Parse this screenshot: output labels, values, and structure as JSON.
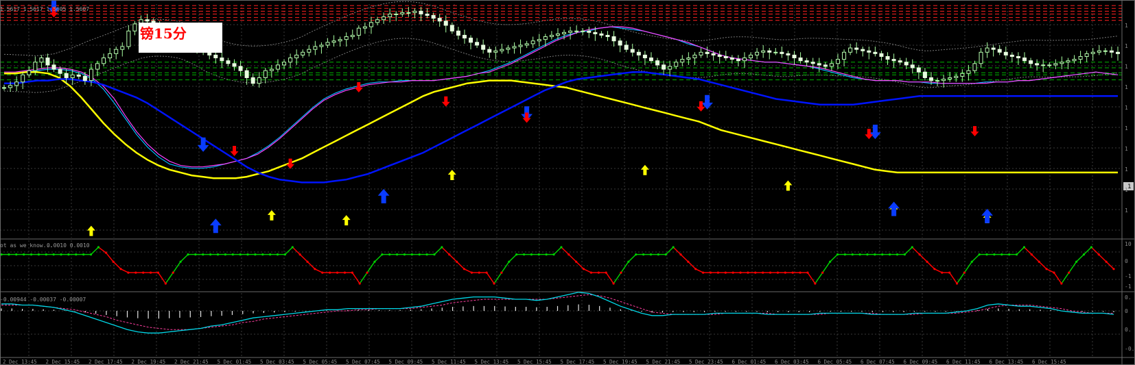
{
  "label": "镑15分",
  "main_panel": {
    "ohlc_readout": "1.5617 1.5617 1.5605 1.5607",
    "price_label": "1"
  },
  "osc_panel": {
    "name": "ot as we know...",
    "values_readout": "0.0010 0.0010",
    "scale": [
      "10",
      "0",
      "-1",
      "-1"
    ]
  },
  "macd_panel": {
    "values_readout": "-0.00944 -0.00037 -0.00007",
    "scale": [
      "0.",
      "0",
      "0.",
      "-0."
    ]
  },
  "colors": {
    "bull": "#b8ffb0",
    "bear": "#e8ffe0",
    "ma_fast": "#00b4ff",
    "ma_slow": "#ff40ff",
    "ma_yellow": "#ffff00",
    "ma_blue": "#0014ff",
    "arrow_down": "#ff0000",
    "arrow_up_yellow": "#ffff00",
    "arrow_up_blue": "#0a3cff",
    "osc_green": "#00d000",
    "osc_red": "#ff0000",
    "level_green": "#00b800",
    "level_red": "#ff2020",
    "macd_signal": "#ff3fa0",
    "macd_main": "#00d8e8"
  },
  "chart_data": {
    "type": "candlestick",
    "x_tick_labels": [
      "2 Dec 13:45",
      "2 Dec 15:45",
      "2 Dec 17:45",
      "2 Dec 19:45",
      "2 Dec 21:45",
      "5 Dec 01:45",
      "5 Dec 03:45",
      "5 Dec 05:45",
      "5 Dec 07:45",
      "5 Dec 09:45",
      "5 Dec 11:45",
      "5 Dec 13:45",
      "5 Dec 15:45",
      "5 Dec 17:45",
      "5 Dec 19:45",
      "5 Dec 21:45",
      "5 Dec 23:45",
      "6 Dec 01:45",
      "6 Dec 03:45",
      "6 Dec 05:45",
      "6 Dec 07:45",
      "6 Dec 09:45",
      "6 Dec 11:45",
      "6 Dec 13:45",
      "6 Dec 15:45"
    ],
    "y_range": [
      0,
      330
    ],
    "closes": [
      212,
      215,
      220,
      230,
      236,
      248,
      254,
      244,
      238,
      232,
      226,
      230,
      228,
      222,
      238,
      246,
      254,
      260,
      266,
      270,
      292,
      302,
      308,
      306,
      300,
      296,
      290,
      288,
      282,
      278,
      274,
      270,
      262,
      258,
      254,
      250,
      246,
      242,
      236,
      226,
      218,
      226,
      236,
      238,
      244,
      248,
      254,
      258,
      262,
      266,
      270,
      272,
      276,
      278,
      280,
      284,
      286,
      296,
      298,
      304,
      308,
      312,
      316,
      316,
      318,
      318,
      320,
      316,
      314,
      310,
      306,
      300,
      292,
      286,
      282,
      276,
      272,
      266,
      262,
      264,
      266,
      268,
      270,
      272,
      274,
      278,
      280,
      284,
      286,
      288,
      290,
      292,
      292,
      292,
      290,
      288,
      286,
      284,
      278,
      272,
      266,
      262,
      258,
      254,
      250,
      244,
      238,
      242,
      248,
      252,
      254,
      258,
      262,
      260,
      258,
      256,
      254,
      252,
      250,
      254,
      258,
      262,
      264,
      262,
      262,
      260,
      258,
      254,
      250,
      248,
      246,
      244,
      242,
      246,
      252,
      262,
      268,
      266,
      264,
      262,
      260,
      256,
      252,
      250,
      248,
      244,
      240,
      234,
      226,
      222,
      222,
      224,
      226,
      228,
      232,
      236,
      246,
      262,
      268,
      266,
      262,
      258,
      256,
      254,
      250,
      246,
      244,
      244,
      244,
      246,
      248,
      250,
      252,
      256,
      260,
      262,
      264,
      264,
      262,
      260
    ],
    "series": [
      {
        "name": "",
        "kind": "ma_fast",
        "values": [
          232,
          232,
          234,
          236,
          238,
          238,
          236,
          232,
          224,
          210,
          190,
          168,
          146,
          128,
          114,
          104,
          100,
          98,
          98,
          100,
          104,
          108,
          112,
          120,
          130,
          142,
          156,
          170,
          184,
          196,
          204,
          210,
          214,
          218,
          220,
          220,
          222,
          222,
          222,
          222,
          224,
          226,
          228,
          232,
          236,
          242,
          248,
          256,
          264,
          272,
          280,
          286,
          290,
          292,
          296,
          298,
          296,
          294,
          292,
          288,
          284,
          280,
          274,
          270,
          264,
          258,
          254,
          252,
          250,
          248,
          248,
          246,
          244,
          242,
          238,
          234,
          230,
          226,
          224,
          222,
          222,
          222,
          220,
          220,
          218,
          218,
          218,
          218,
          218,
          220,
          220,
          220,
          222,
          222,
          224,
          226,
          228,
          230,
          232,
          234,
          232,
          230
        ]
      },
      {
        "name": "",
        "kind": "ma_slow",
        "values": [
          234,
          234,
          236,
          238,
          240,
          240,
          238,
          234,
          226,
          214,
          196,
          172,
          150,
          132,
          118,
          108,
          102,
          100,
          100,
          102,
          104,
          108,
          112,
          118,
          128,
          140,
          154,
          168,
          182,
          194,
          202,
          208,
          212,
          216,
          218,
          220,
          220,
          222,
          222,
          222,
          224,
          226,
          228,
          232,
          234,
          240,
          246,
          254,
          262,
          270,
          278,
          284,
          290,
          294,
          296,
          298,
          298,
          296,
          292,
          288,
          284,
          280,
          276,
          270,
          264,
          258,
          254,
          252,
          250,
          248,
          248,
          246,
          244,
          242,
          240,
          236,
          232,
          228,
          224,
          222,
          222,
          222,
          220,
          220,
          220,
          218,
          218,
          218,
          218,
          218,
          220,
          220,
          222,
          222,
          224,
          226,
          228,
          230,
          232,
          234,
          232,
          230
        ]
      },
      {
        "name": "",
        "kind": "ma_yellow",
        "values": [
          232,
          232,
          234,
          234,
          232,
          226,
          214,
          198,
          180,
          162,
          146,
          132,
          120,
          110,
          102,
          96,
          92,
          88,
          86,
          84,
          84,
          84,
          86,
          90,
          94,
          100,
          106,
          112,
          120,
          128,
          136,
          144,
          152,
          160,
          168,
          176,
          184,
          192,
          200,
          206,
          210,
          214,
          218,
          220,
          222,
          222,
          222,
          220,
          218,
          216,
          214,
          212,
          208,
          204,
          200,
          196,
          192,
          188,
          184,
          180,
          176,
          172,
          168,
          164,
          158,
          152,
          148,
          144,
          140,
          136,
          132,
          128,
          124,
          120,
          116,
          112,
          108,
          104,
          100,
          96,
          94,
          92,
          92,
          92,
          92,
          92,
          92,
          92,
          92,
          92,
          92,
          92,
          92,
          92,
          92,
          92,
          92,
          92,
          92,
          92,
          92,
          92
        ]
      },
      {
        "name": "",
        "kind": "ma_blue",
        "values": [
          218,
          218,
          220,
          222,
          222,
          224,
          224,
          222,
          220,
          216,
          210,
          204,
          198,
          190,
          180,
          170,
          160,
          150,
          140,
          130,
          120,
          110,
          100,
          92,
          86,
          82,
          80,
          78,
          78,
          78,
          80,
          82,
          86,
          90,
          96,
          102,
          108,
          114,
          120,
          128,
          136,
          144,
          152,
          160,
          168,
          176,
          184,
          192,
          200,
          208,
          214,
          220,
          224,
          226,
          228,
          230,
          232,
          234,
          234,
          232,
          230,
          228,
          226,
          224,
          220,
          216,
          212,
          208,
          204,
          200,
          196,
          194,
          192,
          190,
          188,
          188,
          188,
          188,
          190,
          192,
          194,
          196,
          198,
          200,
          200,
          200,
          200,
          200,
          200,
          200,
          200,
          200,
          200,
          200,
          200,
          200,
          200,
          200,
          200,
          200,
          200,
          200
        ]
      }
    ],
    "levels_green": [
      223,
      230,
      233,
      240,
      248
    ],
    "levels_red": [
      307,
      311,
      316,
      320,
      324,
      328
    ],
    "arrows_down_red": [
      {
        "i": 8,
        "v": 316
      },
      {
        "i": 37,
        "v": 120
      },
      {
        "i": 46,
        "v": 102
      },
      {
        "i": 57,
        "v": 210
      },
      {
        "i": 71,
        "v": 190
      },
      {
        "i": 84,
        "v": 167
      },
      {
        "i": 112,
        "v": 183
      },
      {
        "i": 139,
        "v": 144
      },
      {
        "i": 156,
        "v": 148
      }
    ],
    "arrows_down_blue": [
      {
        "i": 8,
        "v": 322
      },
      {
        "i": 32,
        "v": 128
      },
      {
        "i": 84,
        "v": 172
      },
      {
        "i": 113,
        "v": 188
      },
      {
        "i": 140,
        "v": 146
      }
    ],
    "arrows_up_yellow": [
      {
        "i": 14,
        "v": 12
      },
      {
        "i": 43,
        "v": 34
      },
      {
        "i": 55,
        "v": 27
      },
      {
        "i": 72,
        "v": 91
      },
      {
        "i": 103,
        "v": 98
      },
      {
        "i": 126,
        "v": 76
      },
      {
        "i": 143,
        "v": 42
      },
      {
        "i": 158,
        "v": 30
      }
    ],
    "arrows_up_blue": [
      {
        "i": 34,
        "v": 20
      },
      {
        "i": 61,
        "v": 62
      },
      {
        "i": 143,
        "v": 44
      },
      {
        "i": 158,
        "v": 34
      }
    ],
    "oscillator": [
      0.6,
      0.6,
      0.6,
      0.6,
      0.6,
      0.6,
      0.6,
      0.6,
      0.6,
      0.6,
      0.6,
      0.6,
      0.6,
      1,
      0.7,
      0.2,
      -0.2,
      -0.4,
      -0.4,
      -0.4,
      -0.4,
      -0.4,
      -1,
      -0.4,
      0.2,
      0.6,
      0.6,
      0.6,
      0.6,
      0.6,
      0.6,
      0.6,
      0.6,
      0.6,
      0.6,
      0.6,
      0.6,
      0.6,
      0.6,
      1,
      0.6,
      0.2,
      -0.2,
      -0.4,
      -0.4,
      -0.4,
      -0.4,
      -0.4,
      -1,
      -0.4,
      0.2,
      0.6,
      0.6,
      0.6,
      0.6,
      0.6,
      0.6,
      0.6,
      0.6,
      1,
      0.6,
      0.2,
      -0.2,
      -0.4,
      -0.4,
      -0.4,
      -1,
      -0.4,
      0.2,
      0.6,
      0.6,
      0.6,
      0.6,
      0.6,
      0.6,
      1,
      0.6,
      0.2,
      -0.2,
      -0.4,
      -0.4,
      -0.4,
      -1,
      -0.4,
      0.2,
      0.6,
      0.6,
      0.6,
      0.6,
      0.6,
      1,
      0.6,
      0.2,
      -0.2,
      -0.4,
      -0.4,
      -0.4,
      -0.4,
      -0.4,
      -0.4,
      -0.4,
      -0.4,
      -0.4,
      -0.4,
      -0.4,
      -0.4,
      -0.4,
      -0.4,
      -0.4,
      -1,
      -0.4,
      0.2,
      0.6,
      0.6,
      0.6,
      0.6,
      0.6,
      0.6,
      0.6,
      0.6,
      0.6,
      0.6,
      1,
      0.6,
      0.2,
      -0.2,
      -0.4,
      -0.4,
      -1,
      -0.4,
      0.2,
      0.6,
      0.6,
      0.6,
      0.6,
      0.6,
      0.6,
      1,
      0.6,
      0.2,
      -0.2,
      -0.4,
      -1,
      -0.4,
      0.2,
      0.6,
      1,
      0.6,
      0.2,
      -0.2
    ],
    "macd_main": [
      0.06,
      0.06,
      0.05,
      0.05,
      0.04,
      0.03,
      0.01,
      -0.01,
      -0.04,
      -0.07,
      -0.1,
      -0.13,
      -0.16,
      -0.18,
      -0.19,
      -0.19,
      -0.18,
      -0.17,
      -0.16,
      -0.15,
      -0.13,
      -0.12,
      -0.1,
      -0.08,
      -0.06,
      -0.05,
      -0.04,
      -0.03,
      -0.02,
      -0.01,
      0.0,
      0.01,
      0.01,
      0.02,
      0.02,
      0.02,
      0.02,
      0.02,
      0.02,
      0.03,
      0.04,
      0.06,
      0.08,
      0.1,
      0.11,
      0.12,
      0.12,
      0.12,
      0.11,
      0.1,
      0.1,
      0.09,
      0.1,
      0.12,
      0.14,
      0.16,
      0.15,
      0.12,
      0.08,
      0.04,
      0.01,
      -0.02,
      -0.04,
      -0.04,
      -0.03,
      -0.03,
      -0.03,
      -0.03,
      -0.02,
      -0.02,
      -0.02,
      -0.02,
      -0.02,
      -0.03,
      -0.03,
      -0.03,
      -0.03,
      -0.03,
      -0.02,
      -0.02,
      -0.02,
      -0.02,
      -0.02,
      -0.03,
      -0.03,
      -0.03,
      -0.03,
      -0.02,
      -0.02,
      -0.02,
      -0.02,
      -0.01,
      0.0,
      0.02,
      0.05,
      0.06,
      0.05,
      0.04,
      0.04,
      0.03,
      0.02,
      0.0,
      -0.01,
      -0.02,
      -0.02,
      -0.02,
      -0.03
    ],
    "macd_signal": [
      0.05,
      0.05,
      0.05,
      0.05,
      0.04,
      0.03,
      0.02,
      0.01,
      -0.01,
      -0.03,
      -0.05,
      -0.08,
      -0.1,
      -0.12,
      -0.14,
      -0.15,
      -0.16,
      -0.16,
      -0.16,
      -0.15,
      -0.14,
      -0.13,
      -0.12,
      -0.1,
      -0.09,
      -0.07,
      -0.06,
      -0.05,
      -0.04,
      -0.03,
      -0.02,
      -0.01,
      0.0,
      0.0,
      0.01,
      0.01,
      0.02,
      0.02,
      0.02,
      0.02,
      0.03,
      0.04,
      0.05,
      0.07,
      0.08,
      0.09,
      0.1,
      0.1,
      0.1,
      0.1,
      0.1,
      0.1,
      0.1,
      0.11,
      0.12,
      0.13,
      0.14,
      0.13,
      0.11,
      0.08,
      0.05,
      0.02,
      -0.01,
      -0.02,
      -0.03,
      -0.03,
      -0.03,
      -0.03,
      -0.03,
      -0.02,
      -0.02,
      -0.02,
      -0.02,
      -0.02,
      -0.03,
      -0.03,
      -0.03,
      -0.03,
      -0.03,
      -0.02,
      -0.02,
      -0.02,
      -0.02,
      -0.02,
      -0.03,
      -0.03,
      -0.03,
      -0.03,
      -0.02,
      -0.02,
      -0.02,
      -0.02,
      -0.01,
      0.0,
      0.02,
      0.04,
      0.05,
      0.05,
      0.05,
      0.04,
      0.03,
      0.02,
      0.0,
      -0.01,
      -0.02,
      -0.02,
      -0.02
    ]
  }
}
